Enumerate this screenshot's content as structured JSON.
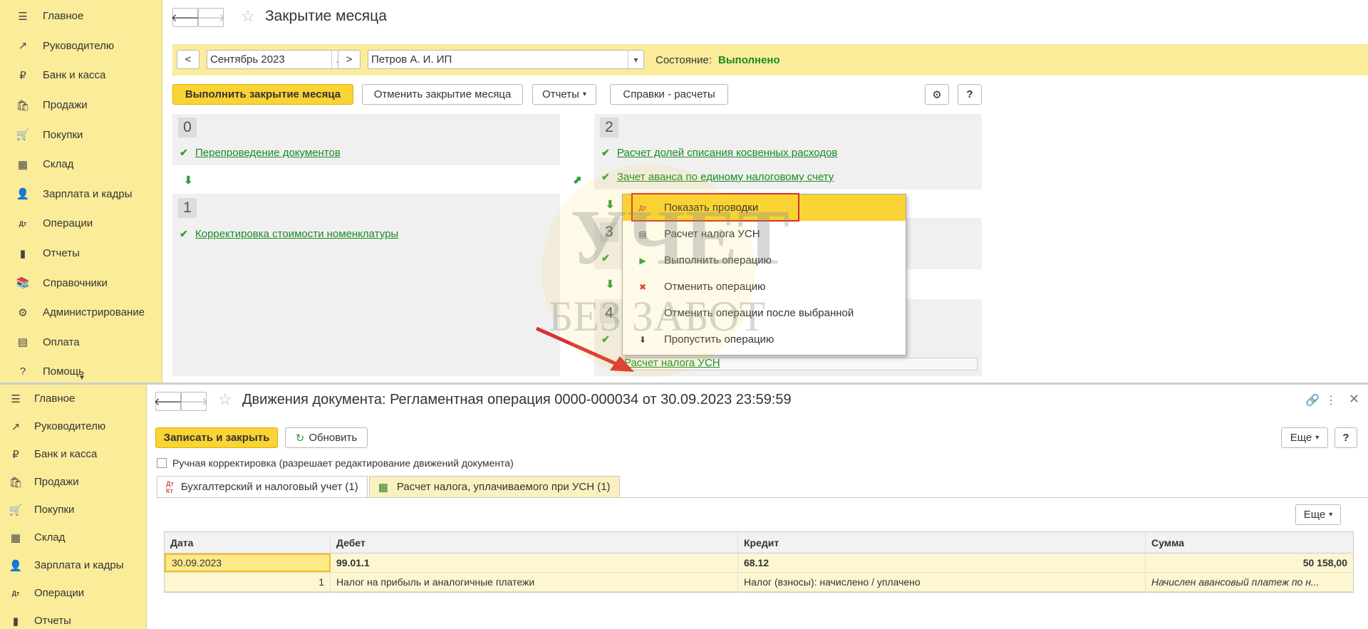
{
  "sidebar_top": {
    "items": [
      {
        "label": "Главное",
        "icon": "menu-icon"
      },
      {
        "label": "Руководителю",
        "icon": "chart-line-icon"
      },
      {
        "label": "Банк и касса",
        "icon": "ruble-coin-icon"
      },
      {
        "label": "Продажи",
        "icon": "shopping-bag-icon"
      },
      {
        "label": "Покупки",
        "icon": "cart-icon"
      },
      {
        "label": "Склад",
        "icon": "warehouse-icon"
      },
      {
        "label": "Зарплата и кадры",
        "icon": "person-icon"
      },
      {
        "label": "Операции",
        "icon": "dt-kt-icon"
      },
      {
        "label": "Отчеты",
        "icon": "bar-chart-icon"
      },
      {
        "label": "Справочники",
        "icon": "books-icon"
      },
      {
        "label": "Администрирование",
        "icon": "gear-icon"
      },
      {
        "label": "Оплата",
        "icon": "payment-icon"
      },
      {
        "label": "Помощь",
        "icon": "help-icon"
      }
    ]
  },
  "sidebar_bottom": {
    "items": [
      {
        "label": "Главное",
        "icon": "menu-icon"
      },
      {
        "label": "Руководителю",
        "icon": "chart-line-icon"
      },
      {
        "label": "Банк и касса",
        "icon": "ruble-coin-icon"
      },
      {
        "label": "Продажи",
        "icon": "shopping-bag-icon"
      },
      {
        "label": "Покупки",
        "icon": "cart-icon"
      },
      {
        "label": "Склад",
        "icon": "warehouse-icon"
      },
      {
        "label": "Зарплата и кадры",
        "icon": "person-icon"
      },
      {
        "label": "Операции",
        "icon": "dt-kt-icon"
      },
      {
        "label": "Отчеты",
        "icon": "bar-chart-icon"
      }
    ]
  },
  "top_window": {
    "title": "Закрытие месяца",
    "prev_label": "<",
    "next_label": ">",
    "period": "Сентябрь 2023",
    "period_btn": "...",
    "organization": "Петров А. И. ИП",
    "state_label": "Состояние:",
    "state_value": "Выполнено",
    "toolbar": {
      "close_month": "Выполнить закрытие месяца",
      "cancel_close": "Отменить закрытие месяца",
      "reports": "Отчеты",
      "calcs": "Справки - расчеты",
      "help": "?"
    },
    "steps": {
      "s0_num": "0",
      "s0_op": "Перепроведение документов",
      "s1_num": "1",
      "s1_op": "Корректировка стоимости номенклатуры",
      "s2_num": "2",
      "s2_op1": "Расчет долей списания косвенных расходов",
      "s2_op2": "Зачет аванса по единому налоговому счету",
      "s3_num": "3",
      "s4_num": "4",
      "s4_op": "Расчет налога УСН"
    },
    "context_menu": [
      {
        "label": "Показать проводки",
        "icon": "dt-kt-icon"
      },
      {
        "label": "Расчет налога УСН",
        "icon": "report-icon"
      },
      {
        "label": "Выполнить операцию",
        "icon": "run-operation-icon"
      },
      {
        "label": "Отменить операцию",
        "icon": "cancel-operation-icon"
      },
      {
        "label": "Отменить операции после выбранной",
        "icon": ""
      },
      {
        "label": "Пропустить операцию",
        "icon": "skip-arrow-icon"
      }
    ]
  },
  "bottom_window": {
    "title": "Движения документа: Регламентная операция 0000-000034 от 30.09.2023 23:59:59",
    "save_close": "Записать и закрыть",
    "refresh": "Обновить",
    "more": "Еще",
    "help": "?",
    "manual_edit": "Ручная корректировка (разрешает редактирование движений документа)",
    "tabs": [
      {
        "label": "Бухгалтерский и налоговый учет (1)",
        "icon": "dt-kt-icon"
      },
      {
        "label": "Расчет налога, уплачиваемого при УСН (1)",
        "icon": "table-icon"
      }
    ],
    "table_more": "Еще",
    "columns": [
      "Дата",
      "Дебет",
      "Кредит",
      "Сумма"
    ],
    "row": {
      "date": "30.09.2023",
      "debit": "99.01.1",
      "credit": "68.12",
      "sum": "50 158,00",
      "num": "1",
      "debit_sub": "Налог на прибыль и аналогичные платежи",
      "credit_sub": "Налог (взносы): начислено / уплачено",
      "content": "Начислен авансовый платеж по н..."
    }
  },
  "watermark": {
    "line1": "УЧЕТ",
    "line2": "БЕЗ ЗАБОТ"
  },
  "colors": {
    "accent": "#fad334",
    "sidebar": "#fbec9a",
    "link": "#1a8a22",
    "highlight": "#d93030"
  }
}
